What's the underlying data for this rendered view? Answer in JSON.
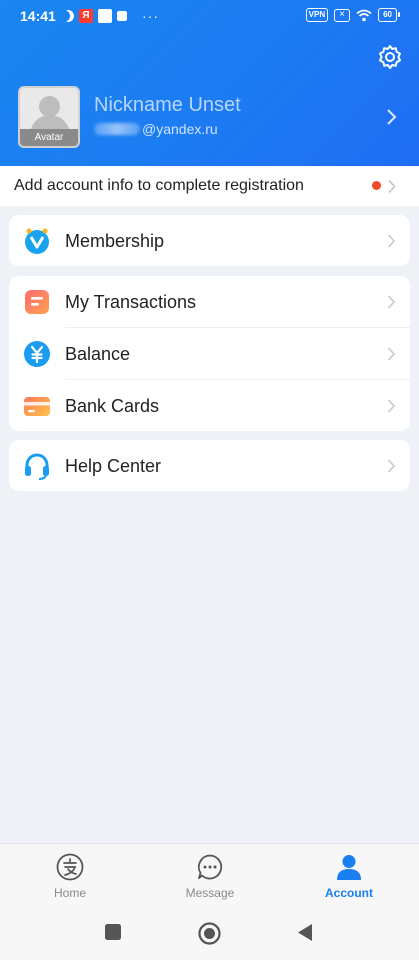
{
  "status_bar": {
    "time": "14:41",
    "left_icons": [
      "moon-icon",
      "yandex-icon",
      "app-icon",
      "app-icon-small"
    ],
    "more": "···",
    "vpn": "VPN",
    "battery": "60"
  },
  "profile": {
    "nickname": "Nickname Unset",
    "email_domain": "@yandex.ru",
    "avatar_label": "Avatar"
  },
  "notice": {
    "text": "Add account info to complete registration"
  },
  "menu": {
    "membership": "Membership",
    "transactions": "My Transactions",
    "balance": "Balance",
    "bank_cards": "Bank Cards",
    "help_center": "Help Center"
  },
  "tabs": {
    "home": "Home",
    "message": "Message",
    "account": "Account",
    "active": "account"
  },
  "colors": {
    "brand": "#1a7ff0",
    "notice_dot": "#f04a2a"
  }
}
